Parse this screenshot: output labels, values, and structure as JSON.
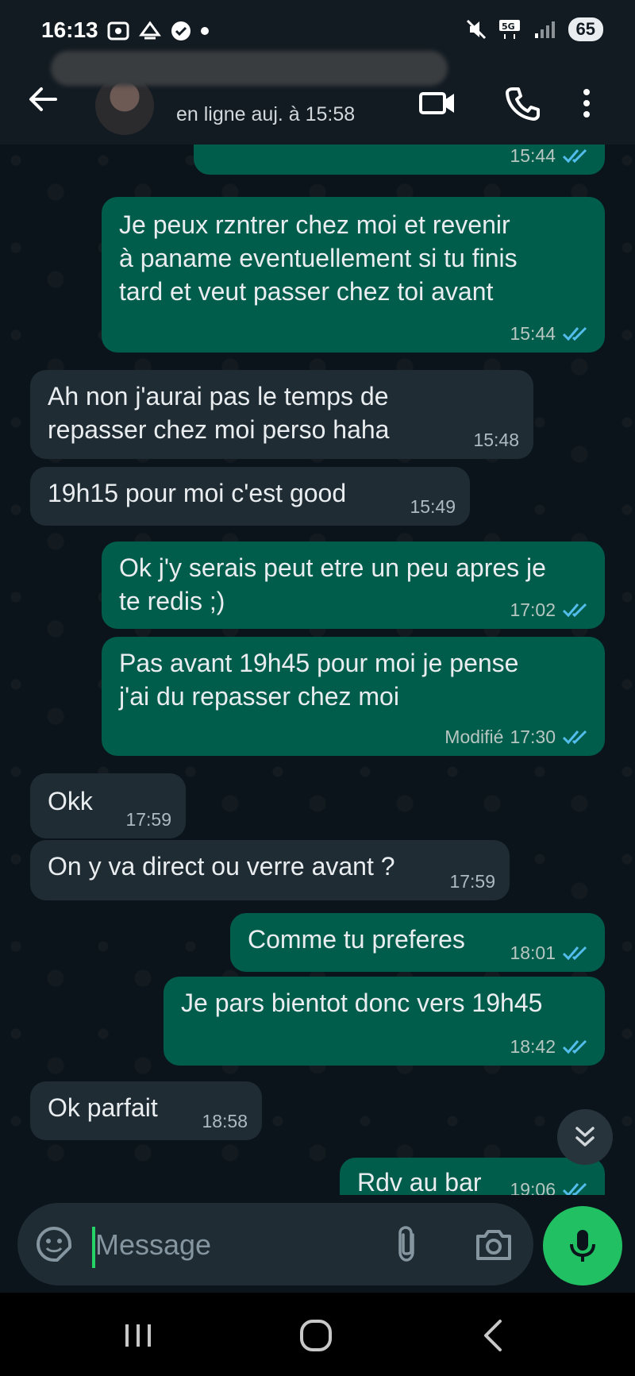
{
  "status_bar": {
    "time": "16:13",
    "battery": "65"
  },
  "header": {
    "subtitle": "en ligne auj. à 15:58"
  },
  "messages": [
    {
      "dir": "out",
      "text": "",
      "time": "15:44"
    },
    {
      "dir": "out",
      "text": "Je peux rzntrer chez moi et revenir\nà paname eventuellement si tu finis\ntard et veut passer chez toi avant",
      "time": "15:44"
    },
    {
      "dir": "in",
      "text": "Ah non j'aurai pas le temps de\nrepasser chez moi perso haha",
      "time": "15:48"
    },
    {
      "dir": "in",
      "text": "19h15 pour moi c'est good",
      "time": "15:49"
    },
    {
      "dir": "out",
      "text": "Ok j'y serais peut etre un peu apres je\nte redis ;)",
      "time": "17:02"
    },
    {
      "dir": "out",
      "text": "Pas avant 19h45 pour moi je pense\nj'ai du repasser chez moi",
      "time": "17:30",
      "edited": "Modifié"
    },
    {
      "dir": "in",
      "text": "Okk",
      "time": "17:59"
    },
    {
      "dir": "in",
      "text": "On y va direct ou verre avant ?",
      "time": "17:59"
    },
    {
      "dir": "out",
      "text": "Comme tu preferes",
      "time": "18:01"
    },
    {
      "dir": "out",
      "text": "Je pars bientot donc vers 19h45",
      "time": "18:42"
    },
    {
      "dir": "in",
      "text": "Ok parfait",
      "time": "18:58"
    },
    {
      "dir": "out",
      "text": "Rdv au bar",
      "time": "19:06"
    }
  ],
  "composer": {
    "placeholder": "Message"
  },
  "colors": {
    "incoming": "#1f2c34",
    "outgoing": "#005c4b",
    "read_ticks": "#53bdeb",
    "mic": "#21c063",
    "background": "#0b141a"
  }
}
